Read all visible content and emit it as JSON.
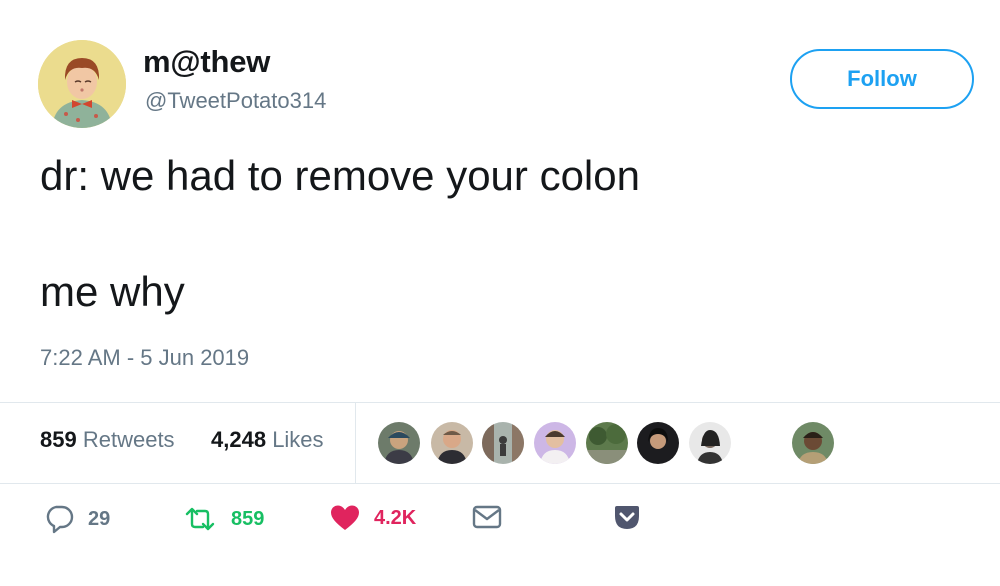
{
  "user": {
    "display_name": "m@thew",
    "handle": "@TweetPotato314"
  },
  "follow_label": "Follow",
  "tweet": {
    "line1": "dr: we had to remove your colon",
    "line2": "me why"
  },
  "timestamp": "7:22 AM - 5 Jun 2019",
  "stats": {
    "retweets_count": "859",
    "retweets_label": "Retweets",
    "likes_count": "4,248",
    "likes_label": "Likes"
  },
  "actions": {
    "reply_count": "29",
    "retweet_count": "859",
    "like_count": "4.2K"
  },
  "colors": {
    "accent": "#1da1f2",
    "retweet": "#17bf63",
    "like": "#e0245e",
    "muted": "#657786",
    "text": "#14171a",
    "pocket": "#50566e"
  },
  "icons": {
    "reply": "reply-icon",
    "retweet": "retweet-icon",
    "like": "heart-icon",
    "dm": "envelope-icon",
    "pocket": "pocket-icon"
  }
}
